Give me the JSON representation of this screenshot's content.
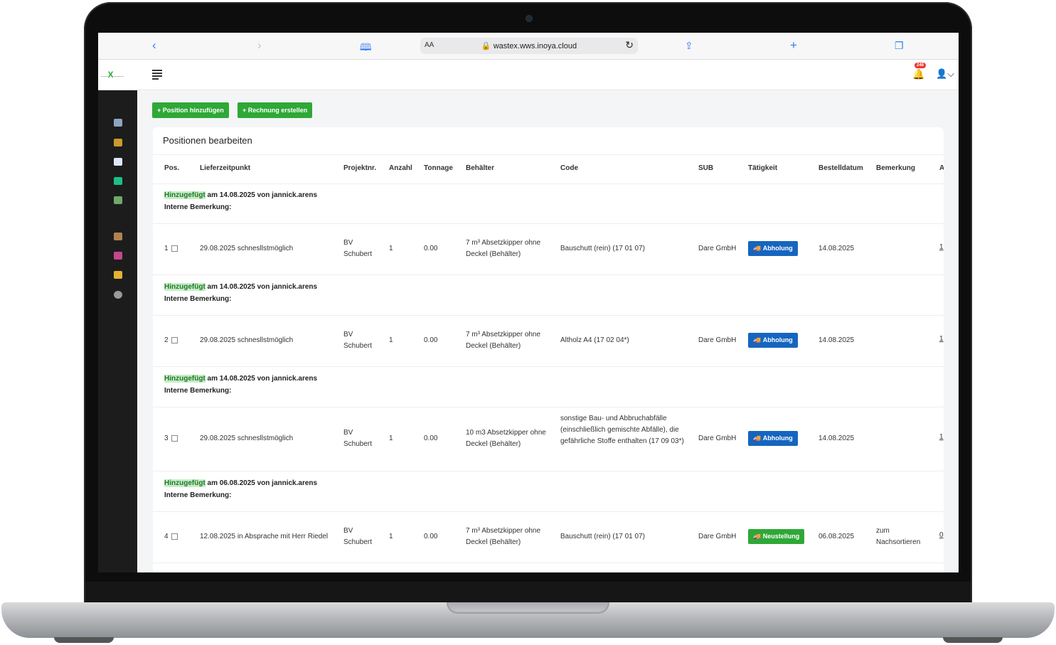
{
  "browser": {
    "url": "wastex.wws.inoya.cloud",
    "text_size_label": "AA",
    "back_icon": "chevron-left-icon",
    "forward_icon": "chevron-right-icon",
    "reader_icon": "book-icon",
    "lock_icon": "lock-icon",
    "reload_icon": "reload-icon",
    "share_icon": "share-icon",
    "new_tab_icon": "plus-icon",
    "tabs_icon": "tabs-icon"
  },
  "header": {
    "notification_count": "248",
    "menu_icon": "hamburger-icon",
    "bell_icon": "bell-icon",
    "user_icon": "user-icon"
  },
  "toolbar": {
    "add_position_label": "Position hinzufügen",
    "create_invoice_label": "Rechnung erstellen"
  },
  "card": {
    "title": "Positionen bearbeiten"
  },
  "table": {
    "columns": [
      "Pos.",
      "Lieferzeitpunkt",
      "Projektnr.",
      "Anzahl",
      "Tonnage",
      "Behälter",
      "Code",
      "SUB",
      "Tätigkeit",
      "Bestelldatum",
      "Bemerkung",
      "A"
    ],
    "groups": [
      {
        "note_added": "Hinzugefügt",
        "note_rest": " am 14.08.2025 von jannick.arens",
        "note_internal": "Interne Bemerkung:",
        "pos": "1",
        "delivery": "29.08.2025 schnesllstmöglich",
        "project": "BV Schubert",
        "count": "1",
        "tonnage": "0.00",
        "container": "7 m³ Absetzkipper ohne Deckel (Behälter)",
        "code": "Bauschutt (rein) (17 01 07)",
        "sub": "Dare GmbH",
        "activity": "Abholung",
        "activity_color": "#1565c0",
        "order_date": "14.08.2025",
        "remark": "",
        "extra": "1"
      },
      {
        "note_added": "Hinzugefügt",
        "note_rest": " am 14.08.2025 von jannick.arens",
        "note_internal": "Interne Bemerkung:",
        "pos": "2",
        "delivery": "29.08.2025 schnesllstmöglich",
        "project": "BV Schubert",
        "count": "1",
        "tonnage": "0.00",
        "container": "7 m³ Absetzkipper ohne Deckel (Behälter)",
        "code": "Altholz A4 (17 02 04*)",
        "sub": "Dare GmbH",
        "activity": "Abholung",
        "activity_color": "#1565c0",
        "order_date": "14.08.2025",
        "remark": "",
        "extra": "1"
      },
      {
        "note_added": "Hinzugefügt",
        "note_rest": " am 14.08.2025 von jannick.arens",
        "note_internal": "Interne Bemerkung:",
        "pos": "3",
        "delivery": "29.08.2025 schnesllstmöglich",
        "project": "BV Schubert",
        "count": "1",
        "tonnage": "0.00",
        "container": "10 m3 Absetzkipper ohne Deckel (Behälter)",
        "code": "sonstige Bau- und Abbruchabfälle (einschließlich gemischte Abfälle), die gefährliche Stoffe enthalten (17 09 03*)",
        "sub": "Dare GmbH",
        "activity": "Abholung",
        "activity_color": "#1565c0",
        "order_date": "14.08.2025",
        "remark": "",
        "extra": "1"
      },
      {
        "note_added": "Hinzugefügt",
        "note_rest": " am 06.08.2025 von jannick.arens",
        "note_internal": "Interne Bemerkung:",
        "pos": "4",
        "delivery": "12.08.2025 in Absprache mit Herr Riedel",
        "project": "BV Schubert",
        "count": "1",
        "tonnage": "0.00",
        "container": "7 m³ Absetzkipper ohne Deckel (Behälter)",
        "code": "Bauschutt (rein) (17 01 07)",
        "sub": "Dare GmbH",
        "activity": "Neustellung",
        "activity_color": "#2ea836",
        "order_date": "06.08.2025",
        "remark": "zum Nachsortieren",
        "extra": "0"
      }
    ]
  }
}
